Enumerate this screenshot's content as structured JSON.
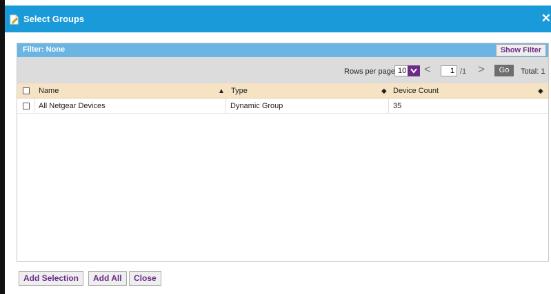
{
  "dialog": {
    "title": "Select Groups",
    "close_glyph": "✕"
  },
  "filter": {
    "text": "Filter: None",
    "show_filter_label": "Show Filter"
  },
  "pager": {
    "rows_per_page_label": "Rows per page",
    "rows_per_page_value": "10",
    "prev_glyph": "<",
    "next_glyph": ">",
    "current_page": "1",
    "total_pages": "/1",
    "go_label": "Go",
    "total_label": "Total: 1"
  },
  "table": {
    "columns": [
      {
        "label": "Name",
        "sort_glyph": "▲"
      },
      {
        "label": "Type",
        "sort_glyph": "◆"
      },
      {
        "label": "Device Count",
        "sort_glyph": "◆"
      }
    ],
    "rows": [
      {
        "name": "All Netgear Devices",
        "type": "Dynamic Group",
        "device_count": "35"
      }
    ]
  },
  "footer": {
    "add_selection_label": "Add Selection",
    "add_all_label": "Add All",
    "close_label": "Close"
  },
  "colors": {
    "titlebar": "#1b9ad9",
    "filterbar": "#6cb4e2",
    "accent": "#6a2c87",
    "header_row": "#f5e3c4"
  },
  "icons": {
    "title": "document-edit-icon",
    "close": "close-icon",
    "dropdown": "chevron-down-icon"
  }
}
